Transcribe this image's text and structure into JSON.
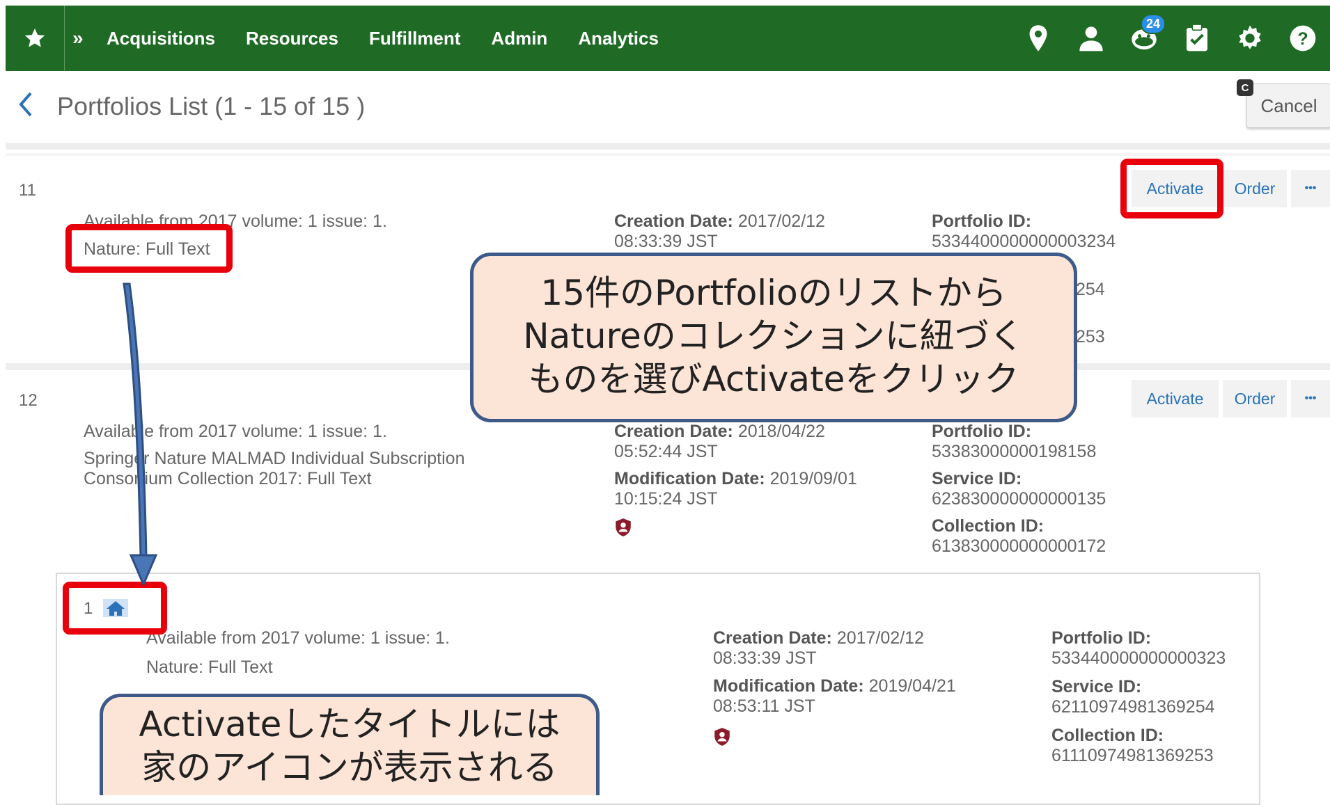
{
  "nav": {
    "items": [
      "Acquisitions",
      "Resources",
      "Fulfillment",
      "Admin",
      "Analytics"
    ],
    "notification_count": "24"
  },
  "header": {
    "title": "Portfolios List (1 - 15 of 15 )",
    "shortcut_key": "C",
    "cancel_label": "Cancel"
  },
  "row11": {
    "number": "11",
    "availability": "Available from 2017 volume: 1 issue: 1.",
    "collection": "Nature: Full Text",
    "creation_label": "Creation Date:",
    "creation_date": "2017/02/12",
    "creation_time": "08:33:39 JST",
    "portfolio_label": "Portfolio ID:",
    "portfolio_id": "5334400000000003234",
    "service_id_tail": "254",
    "collection_id_tail": "253",
    "activate_label": "Activate",
    "order_label": "Order",
    "more_label": "•••"
  },
  "row12": {
    "number": "12",
    "availability": "Available from 2017 volume: 1 issue: 1.",
    "collection_line1": "Springer Nature MALMAD Individual Subscription",
    "collection_line2": "Consortium Collection 2017: Full Text",
    "creation_label": "Creation Date:",
    "creation_date": "2018/04/22",
    "creation_time": "05:52:44 JST",
    "modification_label": "Modification Date:",
    "modification_date": "2019/09/01",
    "modification_time": "10:15:24 JST",
    "portfolio_label": "Portfolio ID:",
    "portfolio_id": "53383000000198158",
    "service_label": "Service ID:",
    "service_id": "623830000000000135",
    "collection_id_label": "Collection ID:",
    "collection_id": "613830000000000172",
    "activate_label": "Activate",
    "order_label": "Order",
    "more_label": "•••"
  },
  "activated": {
    "number": "1",
    "availability": "Available from 2017 volume: 1 issue: 1.",
    "collection": "Nature: Full Text",
    "creation_label": "Creation Date:",
    "creation_date": "2017/02/12",
    "creation_time": "08:33:39 JST",
    "modification_label": "Modification Date:",
    "modification_date": "2019/04/21",
    "modification_time": "08:53:11 JST",
    "portfolio_label": "Portfolio ID:",
    "portfolio_id": "533440000000000323",
    "service_label": "Service ID:",
    "service_id": "62110974981369254",
    "collection_id_label": "Collection ID:",
    "collection_id": "61110974981369253"
  },
  "callouts": {
    "top_line1": "15件のPortfolioのリストから",
    "top_line2": "Natureのコレクションに紐づく",
    "top_line3": "ものを選びActivateをクリック",
    "bottom_line1": "Activateしたタイトルには",
    "bottom_line2": "家のアイコンが表示される"
  },
  "colors": {
    "nav_bg": "#1f6b26",
    "highlight_red": "#e8000b",
    "callout_bg": "#fce4d6",
    "callout_border": "#3e5a8a",
    "arrow": "#4a76b8",
    "link_blue": "#2a73b8"
  }
}
